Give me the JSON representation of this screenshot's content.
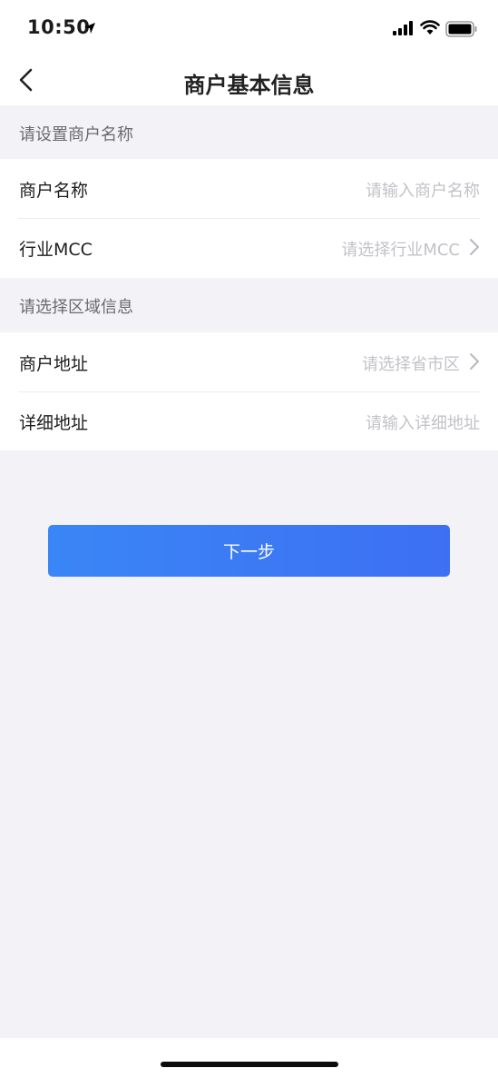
{
  "status_bar": {
    "time": "10:50"
  },
  "nav": {
    "title": "商户基本信息"
  },
  "sections": [
    {
      "header": "请设置商户名称",
      "rows": [
        {
          "label": "商户名称",
          "placeholder": "请输入商户名称",
          "has_chevron": false
        },
        {
          "label": "行业MCC",
          "placeholder": "请选择行业MCC",
          "has_chevron": true
        }
      ]
    },
    {
      "header": "请选择区域信息",
      "rows": [
        {
          "label": "商户地址",
          "placeholder": "请选择省市区",
          "has_chevron": true
        },
        {
          "label": "详细地址",
          "placeholder": "请输入详细地址",
          "has_chevron": false
        }
      ]
    }
  ],
  "next_button": {
    "label": "下一步"
  },
  "colors": {
    "accent": "#3d7ef5",
    "page_bg": "#f3f2f7",
    "placeholder": "#c2c2c8"
  }
}
